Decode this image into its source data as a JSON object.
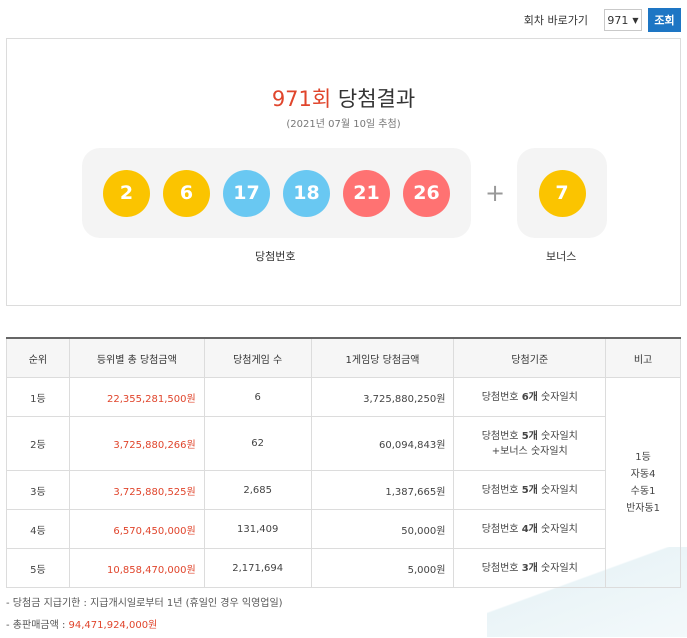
{
  "topbar": {
    "label": "회차 바로가기",
    "selected_round": "971",
    "button": "조회"
  },
  "result": {
    "round": "971회",
    "title_suffix": " 당첨결과",
    "date": "(2021년 07월 10일 추첨)",
    "numbers": [
      {
        "value": "2",
        "color": "#fbc400"
      },
      {
        "value": "6",
        "color": "#fbc400"
      },
      {
        "value": "17",
        "color": "#69c8f2"
      },
      {
        "value": "18",
        "color": "#69c8f2"
      },
      {
        "value": "21",
        "color": "#ff7272"
      },
      {
        "value": "26",
        "color": "#ff7272"
      }
    ],
    "plus": "+",
    "bonus": {
      "value": "7",
      "color": "#fbc400"
    },
    "numbers_label": "당첨번호",
    "bonus_label": "보너스"
  },
  "table": {
    "headers": [
      "순위",
      "등위별 총 당첨금액",
      "당첨게임 수",
      "1게임당 당첨금액",
      "당첨기준",
      "비고"
    ],
    "rows": [
      {
        "rank": "1등",
        "total": "22,355,281,500원",
        "games": "6",
        "per": "3,725,880,250원",
        "crit_a": "당첨번호 ",
        "crit_b": "6개",
        "crit_c": " 숫자일치",
        "crit2": ""
      },
      {
        "rank": "2등",
        "total": "3,725,880,266원",
        "games": "62",
        "per": "60,094,843원",
        "crit_a": "당첨번호 ",
        "crit_b": "5개",
        "crit_c": " 숫자일치",
        "crit2": "+보너스 숫자일치"
      },
      {
        "rank": "3등",
        "total": "3,725,880,525원",
        "games": "2,685",
        "per": "1,387,665원",
        "crit_a": "당첨번호 ",
        "crit_b": "5개",
        "crit_c": " 숫자일치",
        "crit2": ""
      },
      {
        "rank": "4등",
        "total": "6,570,450,000원",
        "games": "131,409",
        "per": "50,000원",
        "crit_a": "당첨번호 ",
        "crit_b": "4개",
        "crit_c": " 숫자일치",
        "crit2": ""
      },
      {
        "rank": "5등",
        "total": "10,858,470,000원",
        "games": "2,171,694",
        "per": "5,000원",
        "crit_a": "당첨번호 ",
        "crit_b": "3개",
        "crit_c": " 숫자일치",
        "crit2": ""
      }
    ],
    "note": [
      "1등",
      "자동4",
      "수동1",
      "반자동1"
    ]
  },
  "notes": {
    "deadline": "당첨금 지급기한 : 지급개시일로부터 1년 (휴일인 경우 익영업일)",
    "sales_label": "총판매금액 : ",
    "sales_value": "94,471,924,000원"
  }
}
